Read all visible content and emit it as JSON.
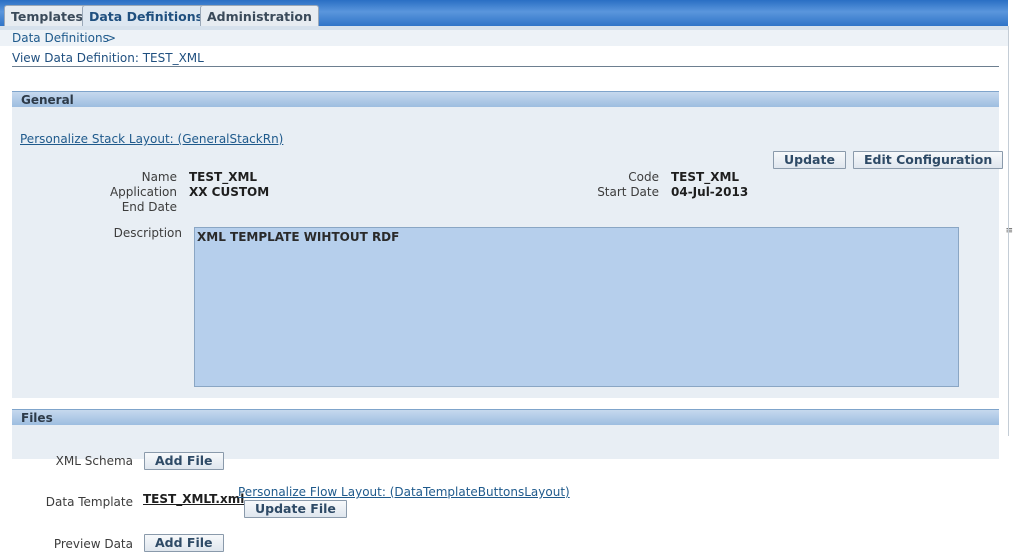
{
  "tabs": [
    {
      "label": "Templates",
      "active": false
    },
    {
      "label": "Data Definitions",
      "active": true
    },
    {
      "label": "Administration",
      "active": false
    }
  ],
  "breadcrumb": {
    "item": "Data Definitions",
    "separator": ">"
  },
  "page_title": "View Data Definition: TEST_XML",
  "general": {
    "header": "General",
    "personalize_link": "Personalize Stack Layout: (GeneralStackRn)",
    "update_button": "Update",
    "edit_config_button": "Edit Configuration",
    "name_label": "Name",
    "name_value": "TEST_XML",
    "application_label": "Application",
    "application_value": "XX CUSTOM",
    "end_date_label": "End Date",
    "end_date_value": "",
    "code_label": "Code",
    "code_value": "TEST_XML",
    "start_date_label": "Start Date",
    "start_date_value": "04-Jul-2013",
    "description_label": "Description",
    "description_value": "XML TEMPLATE WIHTOUT RDF"
  },
  "files": {
    "header": "Files",
    "xml_schema_label": "XML Schema",
    "xml_schema_button": "Add File",
    "data_template_label": "Data Template",
    "data_template_file": "TEST_XMLT.xml",
    "personalize_flow_link": "Personalize Flow Layout: (DataTemplateButtonsLayout)",
    "update_file_button": "Update File",
    "preview_data_label": "Preview Data",
    "preview_data_button": "Add File"
  },
  "colors": {
    "header_blue": "#2a6fc4",
    "section_header": "#9dbde0",
    "panel_bg": "#e8eef4",
    "description_bg": "#b6cfec",
    "link": "#1f5a8c"
  }
}
